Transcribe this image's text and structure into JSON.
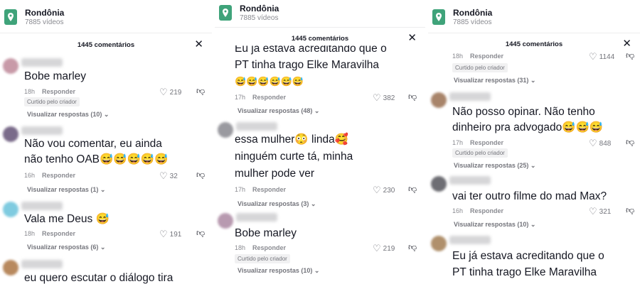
{
  "header": {
    "city": "Rondônia",
    "videos": "7885 vídeos"
  },
  "comments_header": "1445 comentários",
  "close_glyph": "✕",
  "reply_label": "Responder",
  "creator_badge": "Curtido pelo criador",
  "panel1": {
    "c1": {
      "text": "Bobe marley",
      "time": "18h",
      "likes": "219",
      "replies": "Visualizar respostas (10) ⌄"
    },
    "c2": {
      "line1": "Não vou comentar, eu ainda",
      "line2": "não tenho OAB😅😅😅😅😅",
      "time": "16h",
      "likes": "32",
      "replies": "Visualizar respostas (1) ⌄"
    },
    "c3": {
      "text": "Vala me Deus 😅",
      "time": "18h",
      "likes": "191",
      "replies": "Visualizar respostas (6) ⌄"
    },
    "c4": {
      "text": "eu quero escutar o diálogo tira"
    }
  },
  "panel2": {
    "c1": {
      "line0": "Eu já estava acreditando que o",
      "line1": "PT tinha trago Elke Maravilha",
      "line2": "😅😅😅😅😅😅",
      "time": "17h",
      "likes": "382",
      "replies": "Visualizar respostas (48) ⌄"
    },
    "c2": {
      "line1": "essa mulher😳 linda🥰",
      "line2": "ninguém curte tá, minha",
      "line3": "mulher pode ver",
      "time": "17h",
      "likes": "230",
      "replies": "Visualizar respostas (3) ⌄"
    },
    "c3": {
      "text": "Bobe marley",
      "time": "18h",
      "likes": "219",
      "replies": "Visualizar respostas (10) ⌄"
    }
  },
  "panel3": {
    "c0": {
      "time": "18h",
      "likes": "1144",
      "replies": "Visualizar respostas (31) ⌄"
    },
    "c1": {
      "line1": "Não posso opinar. Não tenho",
      "line2": "dinheiro pra advogado😅😅😅",
      "time": "17h",
      "likes": "848",
      "replies": "Visualizar respostas (25) ⌄"
    },
    "c2": {
      "text": "vai ter outro filme do mad Max?",
      "time": "16h",
      "likes": "321",
      "replies": "Visualizar respostas (10) ⌄"
    },
    "c3": {
      "line1": "Eu já estava acreditando que o",
      "line2": "PT tinha trago Elke Maravilha"
    }
  },
  "icons": {
    "like": "heart-outline-icon",
    "dislike": "thumbs-down-icon",
    "close": "close-icon",
    "location": "location-pin-icon"
  },
  "colors": {
    "brand_green": "#3fa37a",
    "text": "#161823",
    "muted": "#8a8b91"
  }
}
